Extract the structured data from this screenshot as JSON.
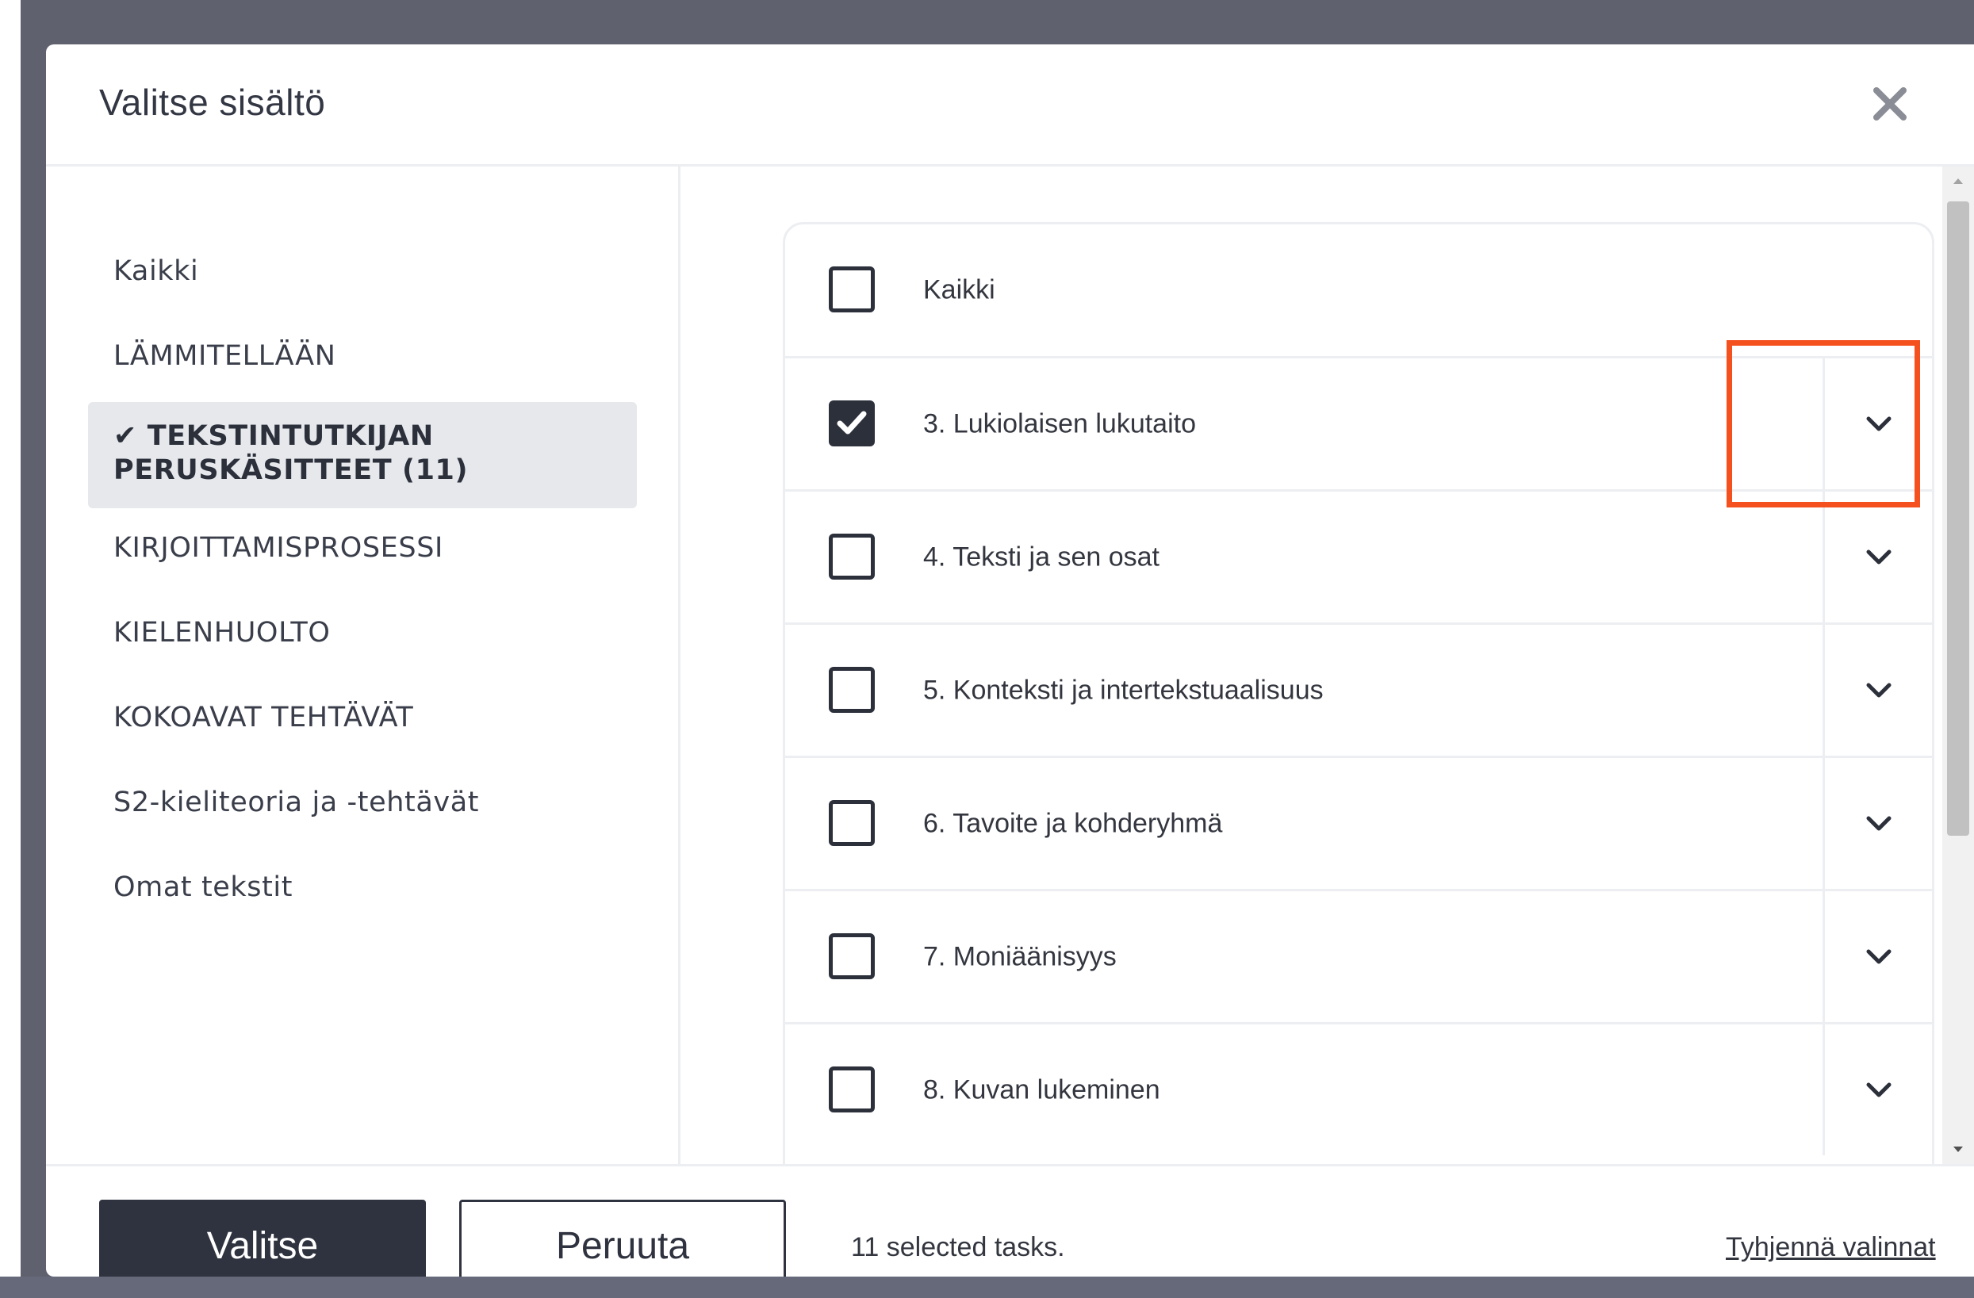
{
  "modal": {
    "title": "Valitse sisältö"
  },
  "sidebar": {
    "items": [
      {
        "label": "Kaikki"
      },
      {
        "label": "LÄMMITELLÄÄN"
      },
      {
        "label": "TEKSTINTUTKIJAN PERUSKÄSITTEET (11)",
        "check": "✔",
        "active": true
      },
      {
        "label": "KIRJOITTAMISPROSESSI"
      },
      {
        "label": "KIELENHUOLTO"
      },
      {
        "label": "KOKOAVAT TEHTÄVÄT"
      },
      {
        "label": "S2-kieliteoria ja -tehtävät"
      },
      {
        "label": "Omat tekstit"
      }
    ]
  },
  "list": {
    "rows": [
      {
        "label": "Kaikki",
        "checked": false,
        "expandable": false
      },
      {
        "label": "3. Lukiolaisen lukutaito",
        "checked": true,
        "expandable": true
      },
      {
        "label": "4. Teksti ja sen osat",
        "checked": false,
        "expandable": true
      },
      {
        "label": "5. Konteksti ja intertekstuaalisuus",
        "checked": false,
        "expandable": true
      },
      {
        "label": "6. Tavoite ja kohderyhmä",
        "checked": false,
        "expandable": true
      },
      {
        "label": "7. Moniäänisyys",
        "checked": false,
        "expandable": true
      },
      {
        "label": "8. Kuvan lukeminen",
        "checked": false,
        "expandable": true
      }
    ]
  },
  "footer": {
    "select_label": "Valitse",
    "cancel_label": "Peruuta",
    "selected_count": "11 selected tasks.",
    "clear_label": "Tyhjennä valinnat"
  },
  "colors": {
    "backdrop": "#5f616e",
    "primary": "#2f323f",
    "highlight": "#f4511e",
    "active_item_bg": "#e6e8ec"
  }
}
